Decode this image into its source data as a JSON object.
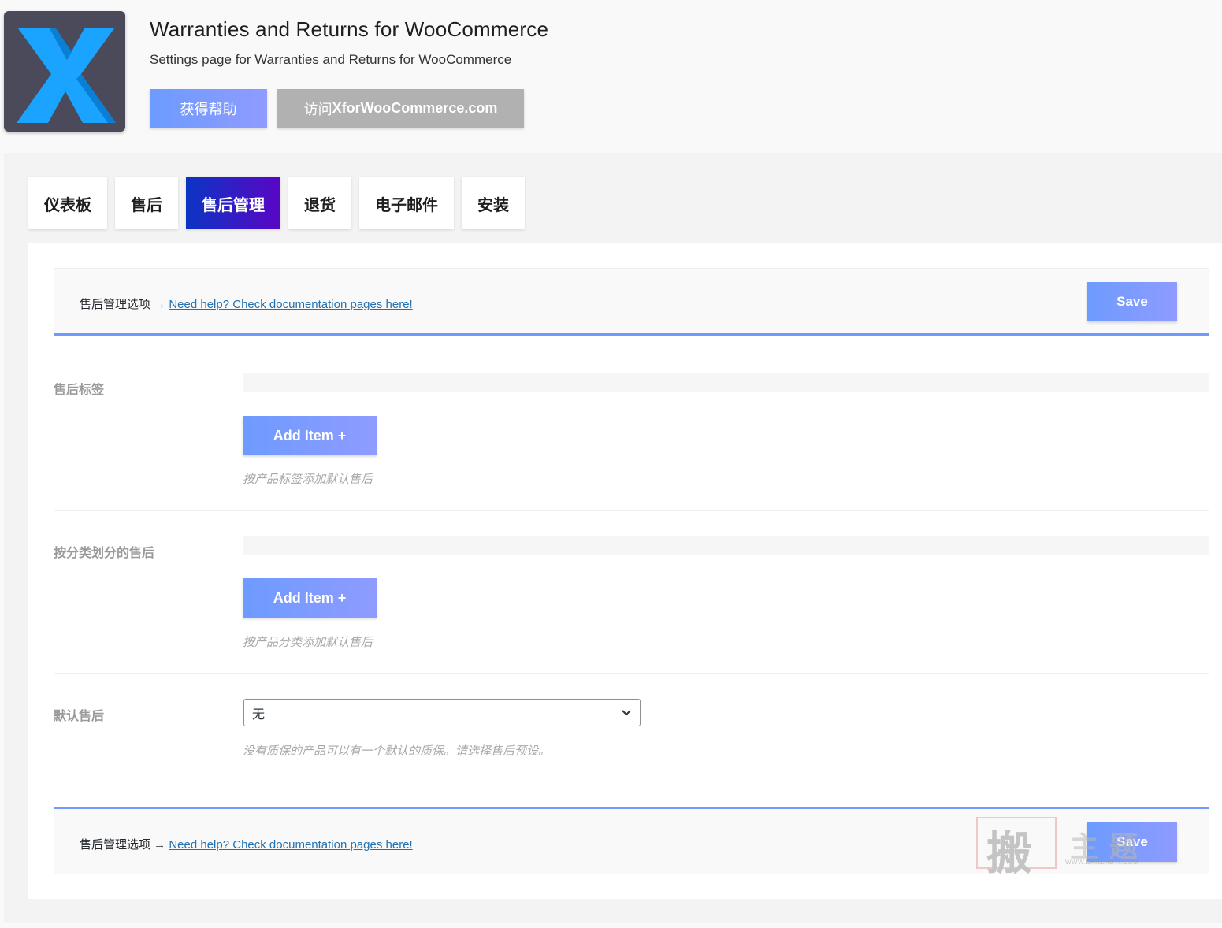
{
  "header": {
    "title": "Warranties and Returns for WooCommerce",
    "subtitle": "Settings page for Warranties and Returns for WooCommerce",
    "help_button": "获得帮助",
    "visit_prefix": "访问",
    "visit_site": "XforWooCommerce.com"
  },
  "tabs": [
    {
      "label": "仪表板"
    },
    {
      "label": "售后"
    },
    {
      "label": "售后管理",
      "active": true
    },
    {
      "label": "退货"
    },
    {
      "label": "电子邮件"
    },
    {
      "label": "安装"
    }
  ],
  "savebar": {
    "options_text": "售后管理选项 →",
    "help_link": "Need help? Check documentation pages here!",
    "save_label": "Save"
  },
  "fields": {
    "tags": {
      "label": "售后标签",
      "add_label": "Add Item +",
      "description": "按产品标签添加默认售后"
    },
    "categories": {
      "label": "按分类划分的售后",
      "add_label": "Add Item +",
      "description": "按产品分类添加默认售后"
    },
    "default": {
      "label": "默认售后",
      "selected": "无",
      "description": "没有质保的产品可以有一个默认的质保。请选择售后预设。"
    }
  },
  "watermark": {
    "chars": [
      "搬",
      "主",
      "题"
    ],
    "url": "WWW.BANZHUTI.COM"
  },
  "colors": {
    "accent": "#6d9bff",
    "tab_active_start": "#0b34c4",
    "tab_active_end": "#5a06c4",
    "logo_bg": "#4a4a5a",
    "logo_x": "#1aa3ff"
  }
}
